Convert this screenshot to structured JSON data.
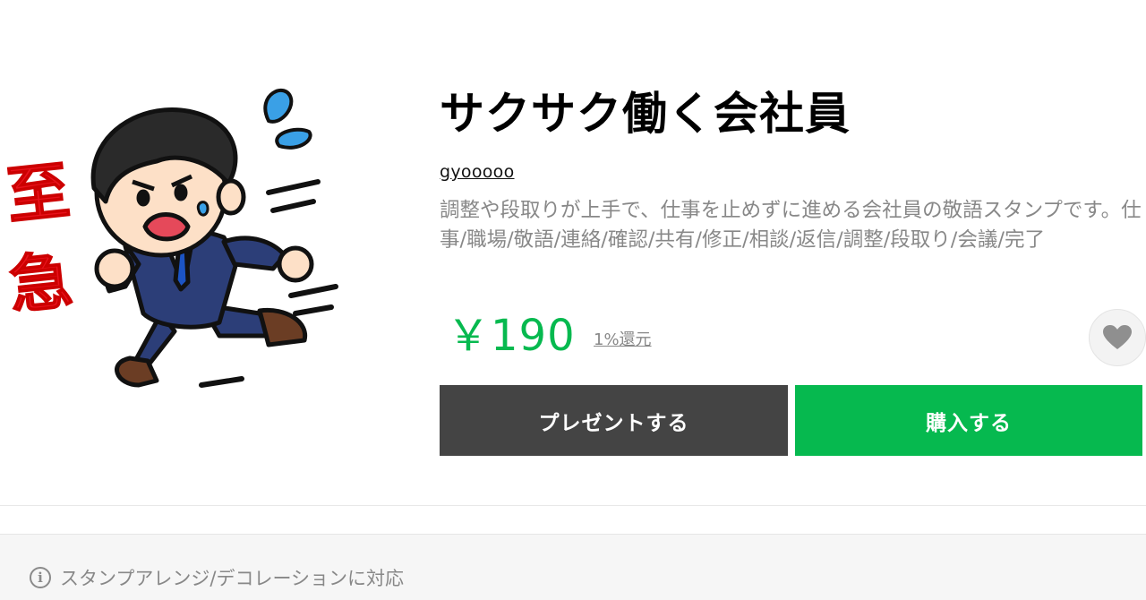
{
  "product": {
    "title": "サクサク働く会社員",
    "author": "gyooooo",
    "description": "調整や段取りが上手で、仕事を止めずに進める会社員の敬語スタンプです。仕事/職場/敬語/連絡/確認/共有/修正/相談/返信/調整/段取り/会議/完了",
    "price": "￥190",
    "points": "1%還元",
    "sticker_text": "至急",
    "favorite_icon": "heart-icon"
  },
  "actions": {
    "gift_label": "プレゼントする",
    "buy_label": "購入する"
  },
  "notice": {
    "icon": "info-icon",
    "icon_glyph": "i",
    "text": "スタンプアレンジ/デコレーションに対応"
  },
  "colors": {
    "accent_green": "#06b94f",
    "gift_button": "#444444",
    "sticker_text_red": "#e8121c",
    "suit_navy": "#2c3e78"
  }
}
